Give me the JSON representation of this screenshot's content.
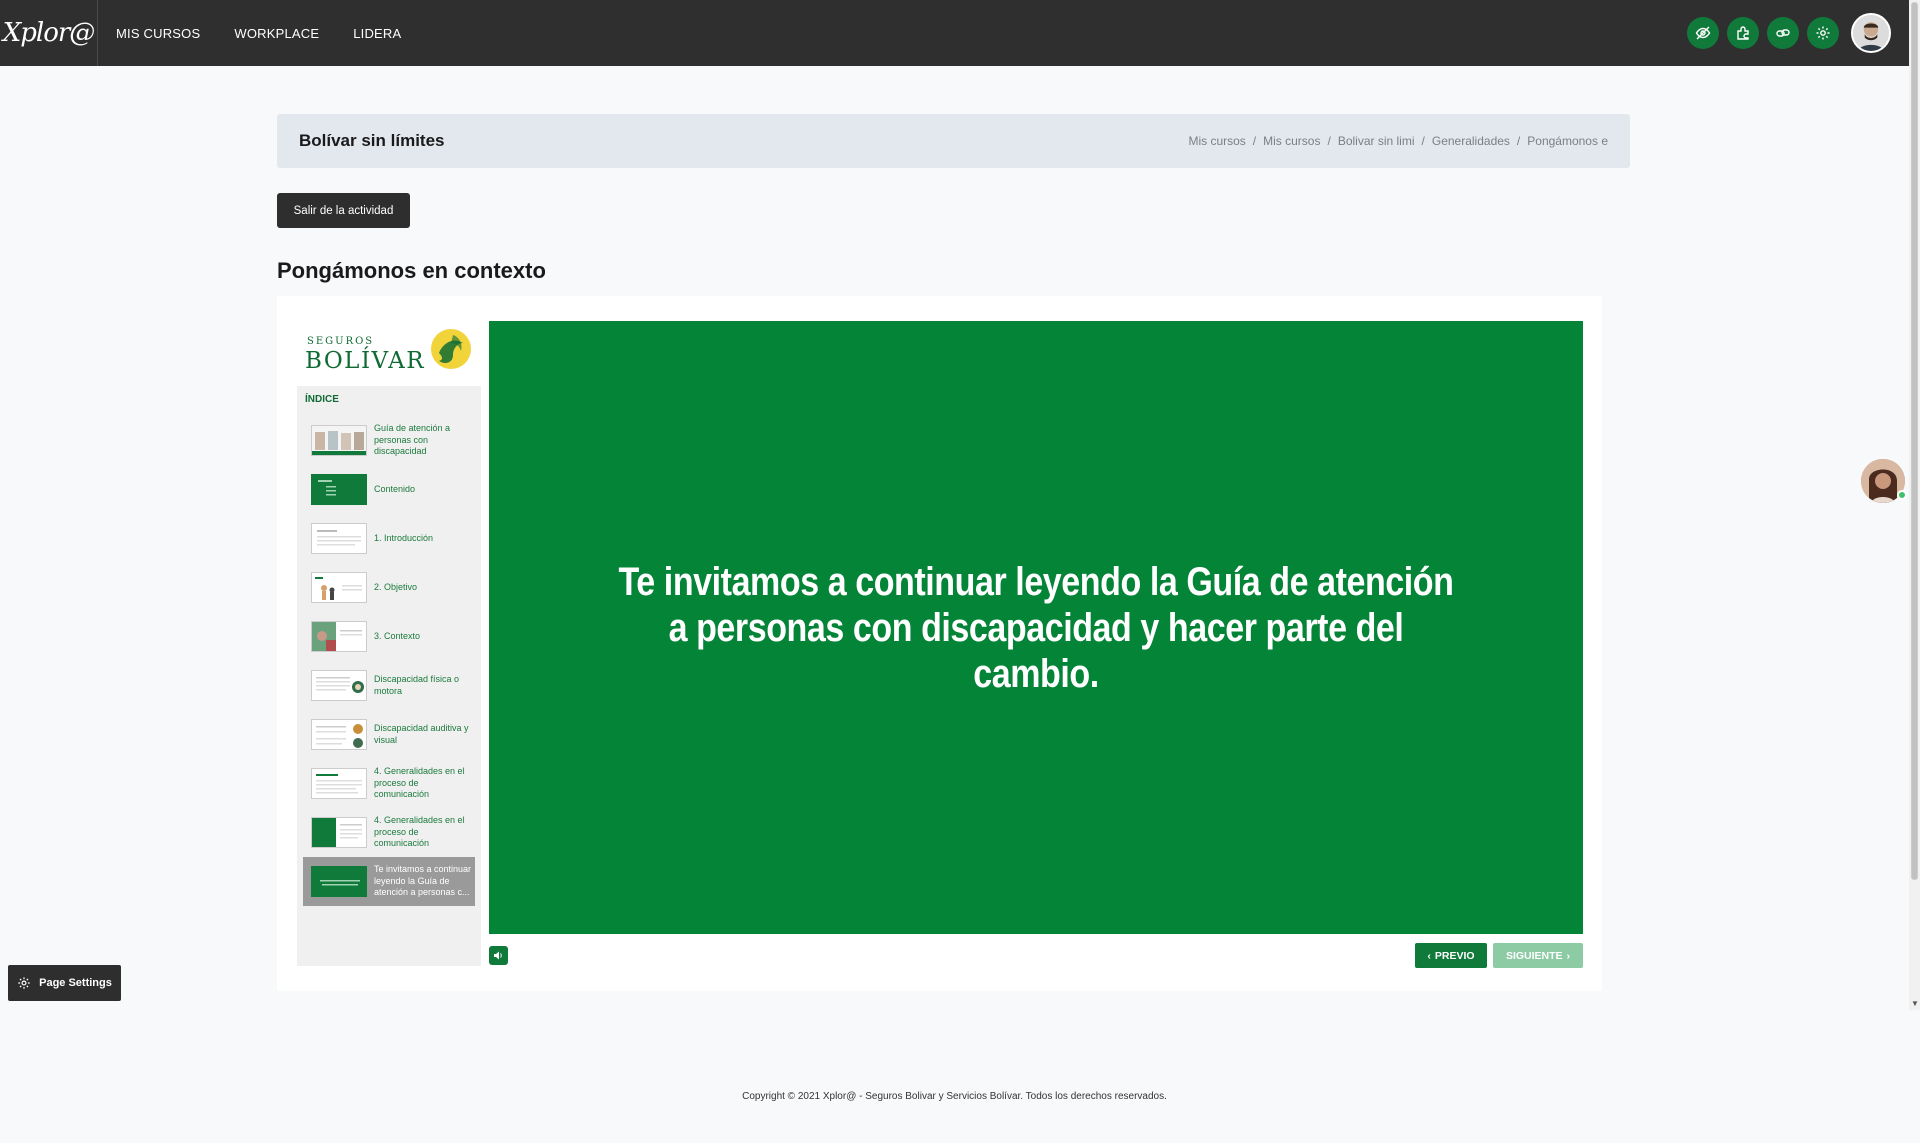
{
  "topbar": {
    "logo_text": "Xplor@",
    "nav": [
      "MIS CURSOS",
      "WORKPLACE",
      "LIDERA"
    ],
    "icons": [
      "eye-slash-icon",
      "puzzle-icon",
      "chain-link-icon",
      "gear-icon"
    ],
    "accent_color": "#0f7a3a"
  },
  "header": {
    "course_title": "Bolívar sin límites",
    "breadcrumb": [
      "Mis cursos",
      "Mis cursos",
      "Bolivar sin limi",
      "Generalidades",
      "Pongámonos e"
    ]
  },
  "exit_button": "Salir de la actividad",
  "activity_title": "Pongámonos en contexto",
  "player": {
    "brand_small": "SEGUROS",
    "brand_big": "BOLÍVAR",
    "index_label": "ÍNDICE",
    "slides": [
      {
        "label": "Guía de atención a personas con discapacidad",
        "thumb": "photo"
      },
      {
        "label": "Contenido",
        "thumb": "green"
      },
      {
        "label": "1. Introducción",
        "thumb": "text"
      },
      {
        "label": "2. Objetivo",
        "thumb": "people"
      },
      {
        "label": "3. Contexto",
        "thumb": "photo2"
      },
      {
        "label": "Discapacidad física o motora",
        "thumb": "text"
      },
      {
        "label": "Discapacidad auditiva y visual",
        "thumb": "text"
      },
      {
        "label": "4. Generalidades en el proceso de comunicación",
        "thumb": "text"
      },
      {
        "label": "4. Generalidades en el proceso de comunicación",
        "thumb": "greentext"
      },
      {
        "label": "Te invitamos a continuar leyendo la Guía de atención a personas c...",
        "thumb": "green",
        "active": true
      }
    ],
    "slide_text": "Te invitamos a continuar leyendo la Guía de atención a personas con discapacidad y hacer parte del cambio.",
    "slide_bg": "#038437",
    "prev_label": "PREVIO",
    "next_label": "SIGUIENTE"
  },
  "page_settings_label": "Page Settings",
  "footer": "Copyright © 2021 Xplor@ - Seguros Bolivar y Servicios Bolívar. Todos los derechos reservados."
}
